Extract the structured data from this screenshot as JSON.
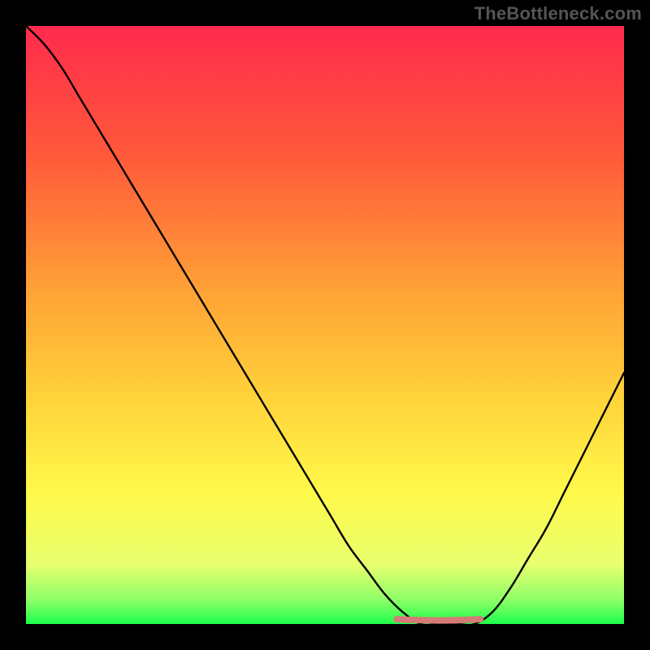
{
  "watermark": "TheBottleneck.com",
  "chart_data": {
    "type": "line",
    "title": "",
    "xlabel": "",
    "ylabel": "",
    "xlim": [
      0,
      100
    ],
    "ylim": [
      0,
      100
    ],
    "grid": false,
    "legend": false,
    "series": [
      {
        "name": "bottleneck-curve",
        "color": "#000000",
        "x": [
          0,
          3,
          6,
          9,
          12,
          15,
          18,
          21,
          24,
          27,
          30,
          33,
          36,
          39,
          42,
          45,
          48,
          51,
          54,
          57,
          60,
          63,
          66,
          69,
          72,
          75,
          78,
          81,
          84,
          87,
          90,
          93,
          96,
          100
        ],
        "y": [
          100,
          97,
          93,
          88,
          83,
          78,
          73,
          68,
          63,
          58,
          53,
          48,
          43,
          38,
          33,
          28,
          23,
          18,
          13,
          9,
          5,
          2,
          0,
          0,
          0,
          0,
          2,
          6,
          11,
          16,
          22,
          28,
          34,
          42
        ]
      }
    ],
    "highlight_segment": {
      "name": "flat-minimum",
      "color": "#d67a78",
      "x": [
        62,
        76
      ],
      "y": [
        0.8,
        0.8
      ]
    },
    "background_gradient": {
      "stops": [
        {
          "offset": 0.0,
          "color": "#ff2a4d"
        },
        {
          "offset": 0.22,
          "color": "#ff5a3a"
        },
        {
          "offset": 0.45,
          "color": "#ffa436"
        },
        {
          "offset": 0.62,
          "color": "#ffd23a"
        },
        {
          "offset": 0.78,
          "color": "#fff94a"
        },
        {
          "offset": 0.9,
          "color": "#e8ff6e"
        },
        {
          "offset": 0.96,
          "color": "#8eff68"
        },
        {
          "offset": 1.0,
          "color": "#1cff4a"
        }
      ]
    }
  }
}
